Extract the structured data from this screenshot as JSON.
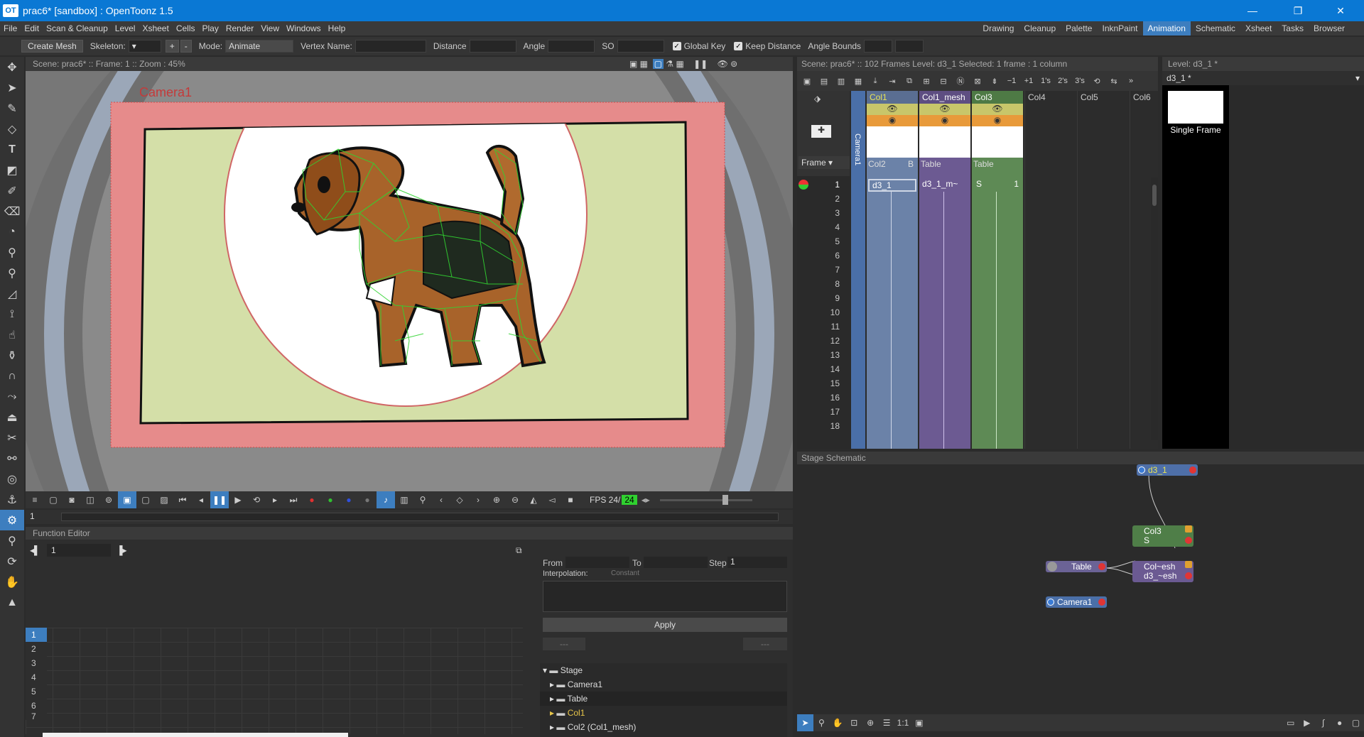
{
  "window": {
    "title": "prac6* [sandbox] : OpenToonz 1.5",
    "logo": "OT",
    "minimize": "—",
    "maximize": "❐",
    "close": "✕"
  },
  "menu": [
    "File",
    "Edit",
    "Scan & Cleanup",
    "Level",
    "Xsheet",
    "Cells",
    "Play",
    "Render",
    "View",
    "Windows",
    "Help"
  ],
  "rooms": [
    "Drawing",
    "Cleanup",
    "Palette",
    "InknPaint",
    "Animation",
    "Schematic",
    "Xsheet",
    "Tasks",
    "Browser"
  ],
  "active_room": "Animation",
  "tool_options": {
    "create_mesh": "Create Mesh",
    "skeleton_label": "Skeleton:",
    "skeleton_value": "",
    "plus": "+",
    "minus": "-",
    "mode_label": "Mode:",
    "mode_value": "Animate",
    "vertex_name_label": "Vertex Name:",
    "distance_label": "Distance",
    "angle_label": "Angle",
    "so_label": "SO",
    "global_key": "Global Key",
    "keep_distance": "Keep Distance",
    "angle_bounds": "Angle Bounds"
  },
  "viewer": {
    "header": "Scene: prac6*  ::  Frame: 1  ::  Zoom : 45%",
    "camera_label": "Camera1",
    "frame_value": "1",
    "fps_label": "FPS 24/",
    "fps_value": "24"
  },
  "function_editor": {
    "title": "Function Editor",
    "frame": "1",
    "from": "From",
    "to": "To",
    "step_label": "Step",
    "step_value": "1",
    "interpolation": "Interpolation:",
    "interp_value": "Constant",
    "apply": "Apply",
    "dash1": "---",
    "dash2": "---",
    "rows": [
      "1",
      "2",
      "3",
      "4",
      "5",
      "6",
      "7"
    ],
    "tree": [
      {
        "label": "Stage",
        "level": 0
      },
      {
        "label": "Camera1",
        "level": 1
      },
      {
        "label": "Table",
        "level": 1
      },
      {
        "label": "Col1",
        "level": 1
      },
      {
        "label": "Col2 (Col1_mesh)",
        "level": 1
      }
    ]
  },
  "xsheet": {
    "header": "Scene: prac6*  ::  102 Frames  Level: d3_1  Selected: 1 frame : 1 column",
    "frame_dropdown": "Frame",
    "camera_col": "Camera1",
    "columns": [
      {
        "name": "Col1",
        "sub": "Col2",
        "flag": "B",
        "cell": "d3_1",
        "color": "#6b82a8"
      },
      {
        "name": "Col1_mesh",
        "sub": "Table",
        "flag": "",
        "cell": "d3_1_m~",
        "color": "#6c5a92"
      },
      {
        "name": "Col3",
        "sub": "Table",
        "flag": "",
        "cell": "S",
        "cell_num": "1",
        "color": "#5e8a55"
      },
      {
        "name": "Col4"
      },
      {
        "name": "Col5"
      },
      {
        "name": "Col6"
      }
    ],
    "frames": [
      "1",
      "2",
      "3",
      "4",
      "5",
      "6",
      "7",
      "8",
      "9",
      "10",
      "11",
      "12",
      "13",
      "14",
      "15",
      "16",
      "17",
      "18"
    ],
    "toolbar_text": [
      "−1",
      "+1",
      "1's",
      "2's",
      "3's"
    ]
  },
  "level_strip": {
    "header": "Level:  d3_1 *",
    "combo": "d3_1 *",
    "frame_label": "Single Frame"
  },
  "schematic": {
    "title": "Stage Schematic",
    "nodes": {
      "d3_1": "d3_1",
      "col3": "Col3",
      "col3_s": "S",
      "table": "Table",
      "colmesh": "Col~esh",
      "d3mesh": "d3_~esh",
      "camera": "Camera1"
    },
    "zoom_label": "1:1"
  },
  "colors": {
    "accent": "#3d7ebf",
    "titlebar": "#0a78d4",
    "camera_box": "#e68b8b",
    "bg_green": "#d4dfa8",
    "mesh_green": "#31d431"
  }
}
